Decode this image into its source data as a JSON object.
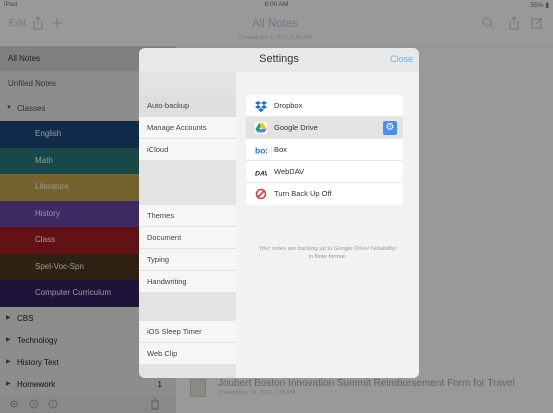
{
  "status": {
    "device": "iPad",
    "time": "6:00 AM",
    "battery": "55%"
  },
  "nav": {
    "edit": "Edit",
    "title": "All Notes",
    "subtitle": "Created Apr 3, 2017, 9:58 AM"
  },
  "sidebar": {
    "all_notes": "All Notes",
    "unfiled": "Unfiled Notes",
    "classes": "Classes",
    "subjects": [
      {
        "label": "English",
        "color": "#1d4a7c"
      },
      {
        "label": "Math",
        "color": "#2a787a"
      },
      {
        "label": "Literature",
        "color": "#c4a44c"
      },
      {
        "label": "History",
        "color": "#6646a3"
      },
      {
        "label": "Class",
        "color": "#a31f22"
      },
      {
        "label": "Spel-Voc-Spn",
        "color": "#4c3a1f"
      },
      {
        "label": "Computer Curriculum",
        "color": "#332062"
      }
    ],
    "cbs": "CBS",
    "technology": "Technology",
    "history_text": "History Text",
    "homework": "Homework",
    "homework_count": "1"
  },
  "note": {
    "title": "Joubert Boston Innovation Summit Reimbursement Form for Travel",
    "date": "Created Dec 19, 2016, 1:45 PM"
  },
  "modal": {
    "title": "Settings",
    "close": "Close",
    "menu": [
      "Auto-backup",
      "Manage Accounts",
      "iCloud",
      "Themes",
      "Document",
      "Typing",
      "Handwriting",
      "iOS Sleep Timer",
      "Web Clip"
    ],
    "options": [
      "Dropbox",
      "Google Drive",
      "Box",
      "WebDAV",
      "Turn Back Up Off"
    ],
    "info": "Your notes are backing up to Google Drive/ Notability/ in Note format."
  },
  "colors": {
    "accent": "#64b5f6",
    "selected_bg": "#e3e3e3"
  }
}
